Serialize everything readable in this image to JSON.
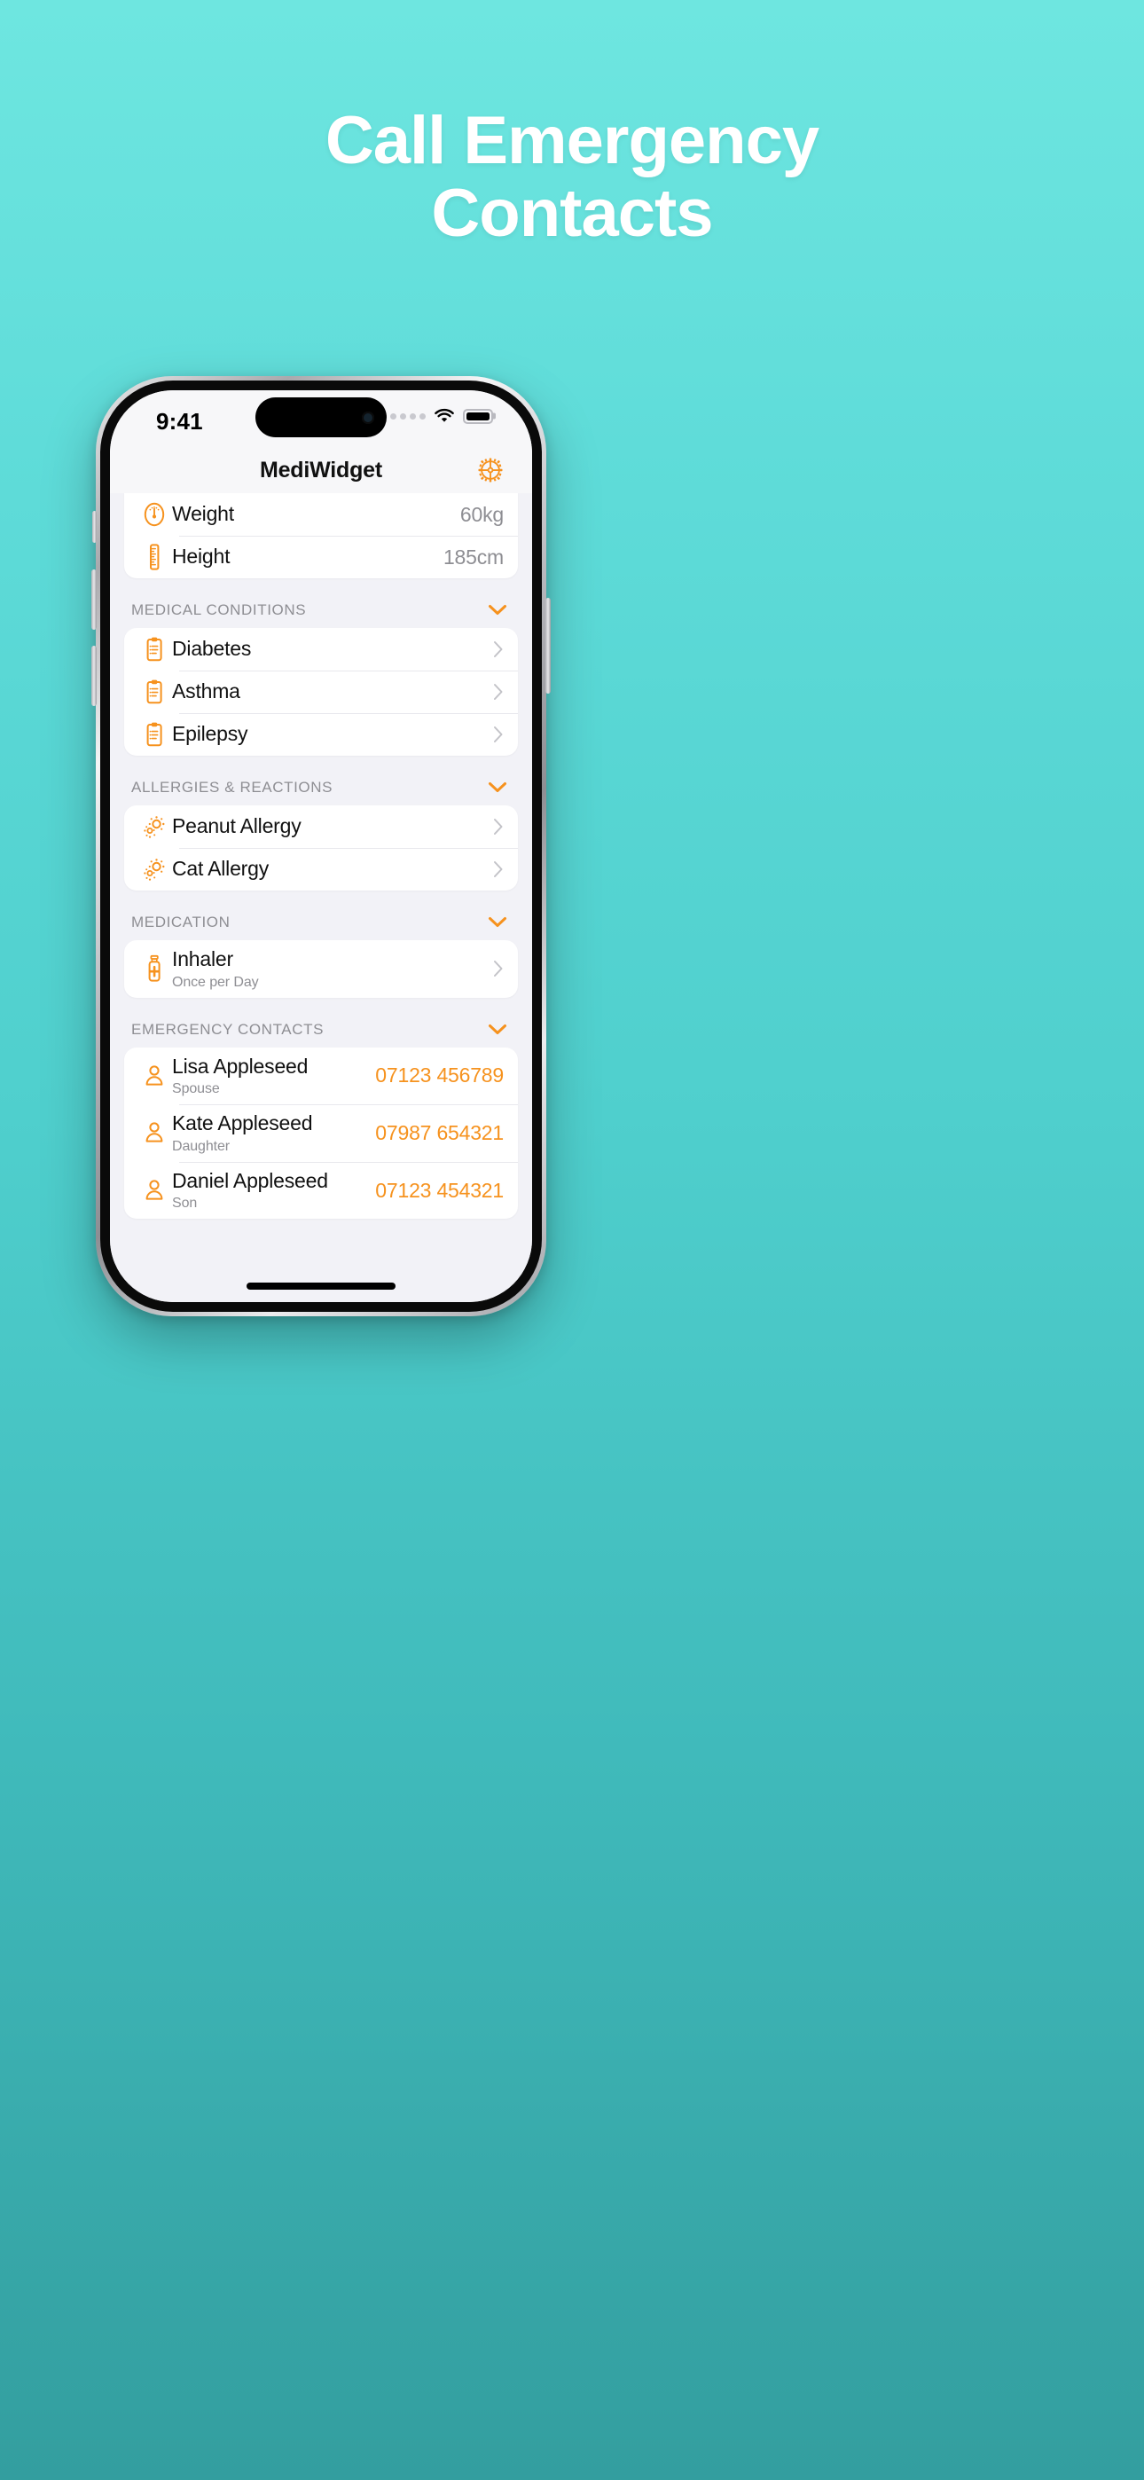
{
  "promo": {
    "headline_line1": "Call Emergency",
    "headline_line2": "Contacts",
    "background_top": "#6ee6e0",
    "background_bottom": "#339e9f"
  },
  "statusbar": {
    "time": "9:41",
    "cellular_icon": "cellular-dots-icon",
    "wifi_icon": "wifi-icon",
    "battery_icon": "battery-full-icon"
  },
  "navbar": {
    "title": "MediWidget",
    "settings_icon": "gear-icon"
  },
  "theme": {
    "accent": "#F6921E",
    "secondary_text": "#8e8e93",
    "screen_bg": "#f2f2f7",
    "card_bg": "#ffffff"
  },
  "vitals": {
    "rows": [
      {
        "icon": "weight-scale-icon",
        "label": "Weight",
        "value": "60kg"
      },
      {
        "icon": "ruler-icon",
        "label": "Height",
        "value": "185cm"
      }
    ]
  },
  "sections": [
    {
      "title": "MEDICAL CONDITIONS",
      "collapse_icon": "chevron-down-icon",
      "rows": [
        {
          "icon": "clipboard-icon",
          "label": "Diabetes",
          "chevron": "chevron-right-icon"
        },
        {
          "icon": "clipboard-icon",
          "label": "Asthma",
          "chevron": "chevron-right-icon"
        },
        {
          "icon": "clipboard-icon",
          "label": "Epilepsy",
          "chevron": "chevron-right-icon"
        }
      ]
    },
    {
      "title": "ALLERGIES & REACTIONS",
      "collapse_icon": "chevron-down-icon",
      "rows": [
        {
          "icon": "allergen-burst-icon",
          "label": "Peanut Allergy",
          "chevron": "chevron-right-icon"
        },
        {
          "icon": "allergen-burst-icon",
          "label": "Cat Allergy",
          "chevron": "chevron-right-icon"
        }
      ]
    },
    {
      "title": "MEDICATION",
      "collapse_icon": "chevron-down-icon",
      "rows": [
        {
          "icon": "medicine-bottle-icon",
          "label": "Inhaler",
          "sub": "Once per Day",
          "chevron": "chevron-right-icon"
        }
      ]
    },
    {
      "title": "EMERGENCY CONTACTS",
      "collapse_icon": "chevron-down-icon",
      "rows": [
        {
          "icon": "person-icon",
          "label": "Lisa Appleseed",
          "sub": "Spouse",
          "phone": "07123 456789"
        },
        {
          "icon": "person-icon",
          "label": "Kate Appleseed",
          "sub": "Daughter",
          "phone": "07987 654321"
        },
        {
          "icon": "person-icon",
          "label": "Daniel Appleseed",
          "sub": "Son",
          "phone": "07123 454321"
        }
      ]
    }
  ]
}
